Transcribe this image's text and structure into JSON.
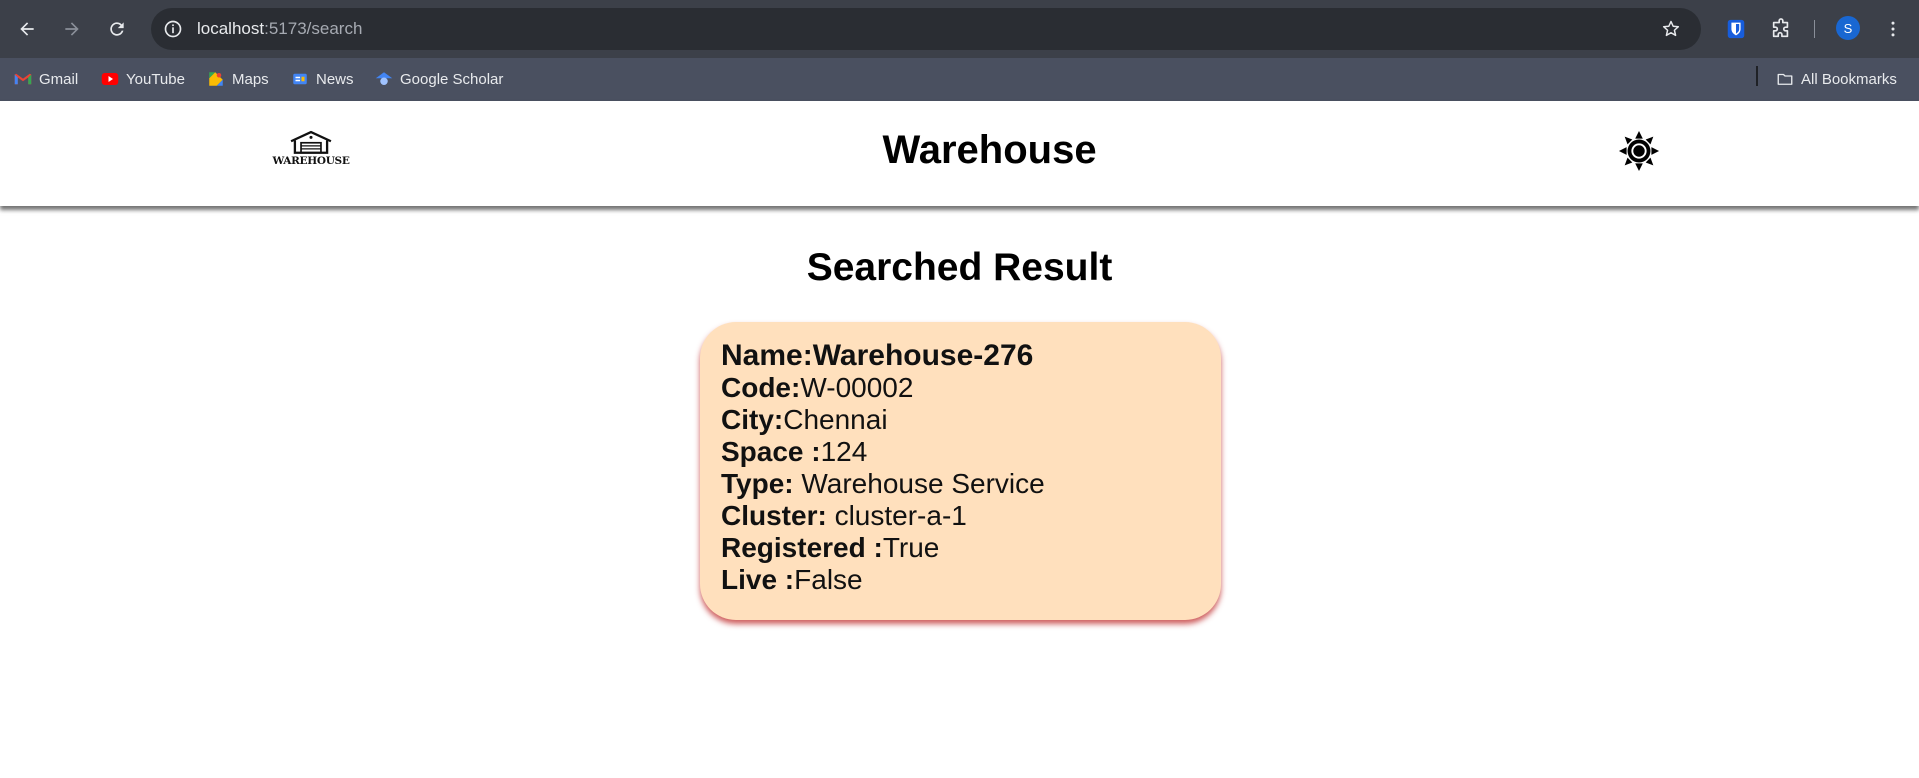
{
  "browser": {
    "url_host": "localhost",
    "url_path": ":5173/search",
    "profile_initial": "S",
    "bookmarks": [
      {
        "label": "Gmail",
        "icon": "gmail-icon"
      },
      {
        "label": "YouTube",
        "icon": "youtube-icon"
      },
      {
        "label": "Maps",
        "icon": "maps-icon"
      },
      {
        "label": "News",
        "icon": "news-icon"
      },
      {
        "label": "Google Scholar",
        "icon": "scholar-icon"
      }
    ],
    "all_bookmarks_label": "All Bookmarks"
  },
  "header": {
    "logo_text": "WAREHOUSE",
    "title": "Warehouse",
    "theme_icon": "sun-icon"
  },
  "main": {
    "title": "Searched Result",
    "card": {
      "name_key": "Name:",
      "name_value": "Warehouse-276",
      "code_key": "Code:",
      "code_value": "W-00002",
      "city_key": "City:",
      "city_value": "Chennai",
      "space_key": "Space :",
      "space_value": "124",
      "type_key": "Type:",
      "type_value": " Warehouse Service",
      "cluster_key": "Cluster:",
      "cluster_value": " cluster-a-1",
      "registered_key": "Registered :",
      "registered_value": "True",
      "live_key": "Live :",
      "live_value": "False"
    }
  },
  "colors": {
    "card_background": "#ffe0bd",
    "card_shadow": "#be2828",
    "chrome_toolbar": "#3c4049",
    "chrome_bookmarks": "#4a5060"
  }
}
